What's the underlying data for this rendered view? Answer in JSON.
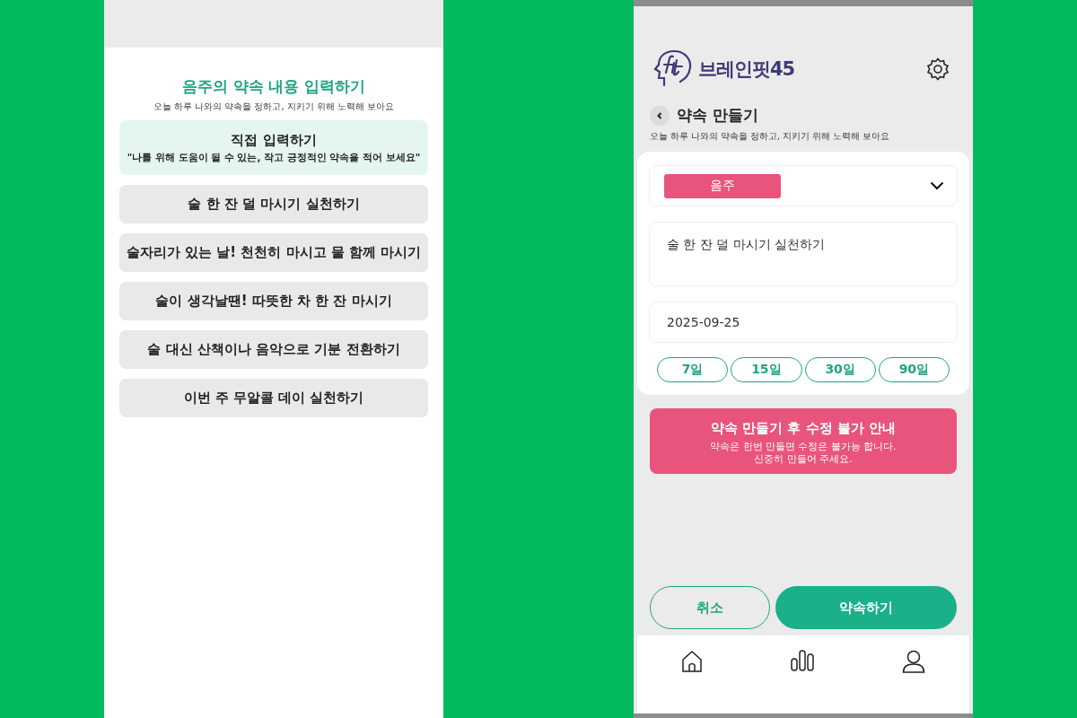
{
  "left_screen": {
    "title": "음주의 약속 내용 입력하기",
    "subtitle": "오늘 하루 나와의 약속을 정하고, 지키기 위해 노력해 보아요",
    "options": [
      {
        "kind": "custom",
        "label": "직접 입력하기",
        "hint": "\"나를 위해 도움이 될 수 있는, 작고 긍정적인 약속을 적어 보세요\""
      },
      {
        "kind": "preset",
        "label": "술 한 잔 덜 마시기 실천하기"
      },
      {
        "kind": "preset",
        "label": "술자리가 있는 날! 천천히 마시고 물 함께 마시기"
      },
      {
        "kind": "preset",
        "label": "술이 생각날땐! 따뜻한 차 한 잔 마시기"
      },
      {
        "kind": "preset",
        "label": "술 대신 산책이나 음악으로 기분 전환하기"
      },
      {
        "kind": "preset",
        "label": "이번 주 무알콜 데이 실천하기"
      }
    ]
  },
  "right_screen": {
    "app_name": "브레인핏45",
    "page_title": "약속 만들기",
    "subtitle": "오늘 하루 나와의 약속을 정하고, 지키기 위해 노력해 보아요",
    "category": {
      "label": "음주",
      "color": "#e8547c"
    },
    "promise_text": "술 한 잔 덜 마시기 실천하기",
    "date": "2025-09-25",
    "durations": [
      "7일",
      "15일",
      "30일",
      "90일"
    ],
    "notice": {
      "title": "약속 만들기 후 수정 불가 안내",
      "lines": [
        "약속은 한번 만들면 수정은 불가능 합니다.",
        "신중히 만들어 주세요."
      ]
    },
    "buttons": [
      {
        "kind": "secondary",
        "label": "취소"
      },
      {
        "kind": "primary",
        "label": "약속하기"
      }
    ]
  }
}
